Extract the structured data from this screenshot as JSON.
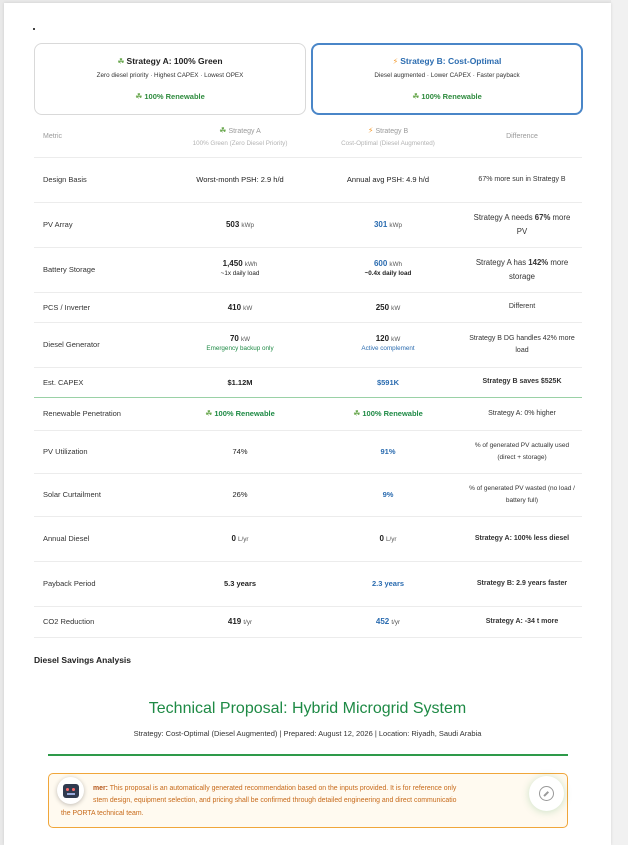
{
  "strategy_a": {
    "title": "Strategy A: 100% Green",
    "subtitle": "Zero diesel priority · Highest CAPEX · Lowest OPEX",
    "tag": "100% Renewable"
  },
  "strategy_b": {
    "title": "Strategy B: Cost-Optimal",
    "subtitle": "Diesel augmented · Lower CAPEX · Faster payback",
    "tag": "100% Renewable"
  },
  "table": {
    "header": {
      "metric": "Metric",
      "a_title": "Strategy A",
      "a_sub": "100% Green (Zero Diesel Priority)",
      "b_title": "Strategy B",
      "b_sub": "Cost-Optimal (Diesel Augmented)",
      "difference": "Difference"
    },
    "rows": {
      "design_basis": {
        "metric": "Design Basis",
        "a": "Worst-month PSH: 2.9 h/d",
        "b": "Annual avg PSH: 4.9 h/d",
        "diff": "67% more sun in Strategy B"
      },
      "pv_array": {
        "metric": "PV Array",
        "a": "503",
        "a_unit": "kWp",
        "b": "301",
        "b_unit": "kWp",
        "diff_pre": "Strategy A needs ",
        "diff_bold": "67%",
        "diff_post": " more PV"
      },
      "battery": {
        "metric": "Battery Storage",
        "a": "1,450",
        "a_unit": "kWh",
        "a_note": "~1x daily load",
        "b": "600",
        "b_unit": "kWh",
        "b_note": "~0.4x daily load",
        "diff_pre": "Strategy A has ",
        "diff_bold": "142%",
        "diff_post": " more storage"
      },
      "pcs": {
        "metric": "PCS / Inverter",
        "a": "410",
        "a_unit": "kW",
        "b": "250",
        "b_unit": "kW",
        "diff": "Different"
      },
      "diesel_gen": {
        "metric": "Diesel Generator",
        "a": "70",
        "a_unit": "kW",
        "a_note": "Emergency backup only",
        "b": "120",
        "b_unit": "kW",
        "b_note": "Active complement",
        "diff": "Strategy B DG handles 42% more load"
      },
      "capex": {
        "metric": "Est. CAPEX",
        "a": "$1.12M",
        "b": "$591K",
        "diff": "Strategy B saves $525K"
      },
      "renewable": {
        "metric": "Renewable Penetration",
        "a": "100% Renewable",
        "b": "100% Renewable",
        "diff": "Strategy A: 0% higher"
      },
      "pv_util": {
        "metric": "PV Utilization",
        "a": "74%",
        "b": "91%",
        "diff": "% of generated PV actually used (direct + storage)"
      },
      "curtail": {
        "metric": "Solar Curtailment",
        "a": "26%",
        "b": "9%",
        "diff": "% of generated PV wasted (no load / battery full)"
      },
      "annual_diesel": {
        "metric": "Annual Diesel",
        "a": "0",
        "a_unit": "L/yr",
        "b": "0",
        "b_unit": "L/yr",
        "diff": "Strategy A: 100% less diesel"
      },
      "payback": {
        "metric": "Payback Period",
        "a": "5.3 years",
        "b": "2.3 years",
        "diff": "Strategy B: 2.9 years faster"
      },
      "co2": {
        "metric": "CO2 Reduction",
        "a": "419",
        "a_unit": "t/yr",
        "b": "452",
        "b_unit": "t/yr",
        "diff": "Strategy A: -34 t more"
      }
    }
  },
  "diesel_savings_title": "Diesel Savings Analysis",
  "proposal": {
    "title": "Technical Proposal: Hybrid Microgrid System",
    "meta": "Strategy: Cost-Optimal (Diesel Augmented) | Prepared: August 12, 2026 | Location: Riyadh, Saudi Arabia"
  },
  "disclaimer": {
    "label": "mer:",
    "line1": " This proposal is an automatically generated recommendation based on the inputs provided. It is for reference only",
    "line2": "stem design, equipment selection, and pricing shall be confirmed through detailed engineering and direct communicatio",
    "line3": "the PORTA technical team."
  },
  "colors": {
    "green": "#1e8a45",
    "blue": "#2b6cb0",
    "orange_border": "#f0a63a"
  },
  "icons": {
    "renewable": "leaf-icon",
    "cost": "lightning-icon",
    "assistant": "robot-icon",
    "chat": "chat-icon"
  }
}
